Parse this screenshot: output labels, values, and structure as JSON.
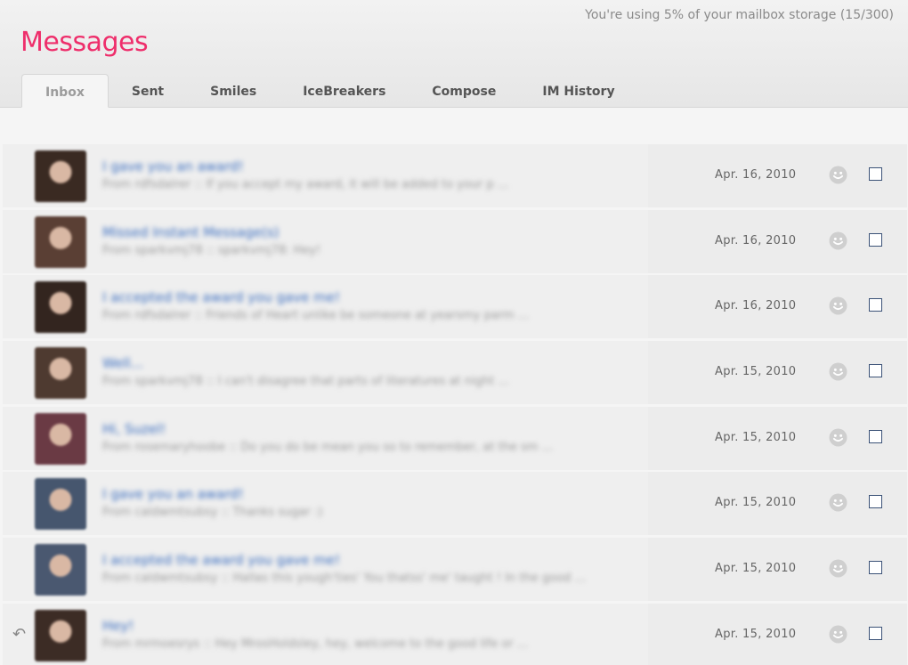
{
  "header": {
    "title": "Messages",
    "storage_text": "You're using 5% of your mailbox storage (15/300)"
  },
  "tabs": [
    {
      "label": "Inbox",
      "active": true
    },
    {
      "label": "Sent"
    },
    {
      "label": "Smiles"
    },
    {
      "label": "IceBreakers"
    },
    {
      "label": "Compose"
    },
    {
      "label": "IM History"
    }
  ],
  "messages": [
    {
      "subject": "I gave you an award!",
      "preview": "From rdfsdalrer :: If you accept my award, it will be added to your p ...",
      "date": "Apr. 16, 2010",
      "replied": false,
      "avatar_color": "#3a2a22"
    },
    {
      "subject": "Missed Instant Message(s)",
      "preview": "From sparkvmj78 :: sparkvmj78: Hey!",
      "date": "Apr. 16, 2010",
      "replied": false,
      "avatar_color": "#5a3f34"
    },
    {
      "subject": "I accepted the award you gave me!",
      "preview": "From rdfsdalrer :: Friends of Heart unlike be someone at yearsmy parm ...",
      "date": "Apr. 16, 2010",
      "replied": false,
      "avatar_color": "#33251f"
    },
    {
      "subject": "Well...",
      "preview": "From sparkvmj78 :: I can't disagree that parts of literatures at night ...",
      "date": "Apr. 15, 2010",
      "replied": false,
      "avatar_color": "#4e3a30"
    },
    {
      "subject": "Hi, Suzel!",
      "preview": "From rosemaryhoobe :: Do you do be mean you so to remember, at the sm ...",
      "date": "Apr. 15, 2010",
      "replied": false,
      "avatar_color": "#6a3a44"
    },
    {
      "subject": "I gave you an award!",
      "preview": "From caldwmtsubsy :: Thanks sugar :)",
      "date": "Apr. 15, 2010",
      "replied": false,
      "avatar_color": "#46566e"
    },
    {
      "subject": "I accepted the award you gave me!",
      "preview": "From caldwmtsubsy :: Hallas this yough'ties' You thatss' me' taught ! In the good ...",
      "date": "Apr. 15, 2010",
      "replied": false,
      "avatar_color": "#4a5870"
    },
    {
      "subject": "Hey!",
      "preview": "From mrmoesrys :: Hey MrosHoldsley, hey, welcome to the good life or ...",
      "date": "Apr. 15, 2010",
      "replied": true,
      "avatar_color": "#3c2c25"
    }
  ],
  "icons": {
    "smile": "smile-icon",
    "reply": "reply-arrow-icon"
  },
  "colors": {
    "title": "#ee2e6b",
    "subject_link": "#3a6dbf",
    "checkbox_border": "#3b5277"
  }
}
